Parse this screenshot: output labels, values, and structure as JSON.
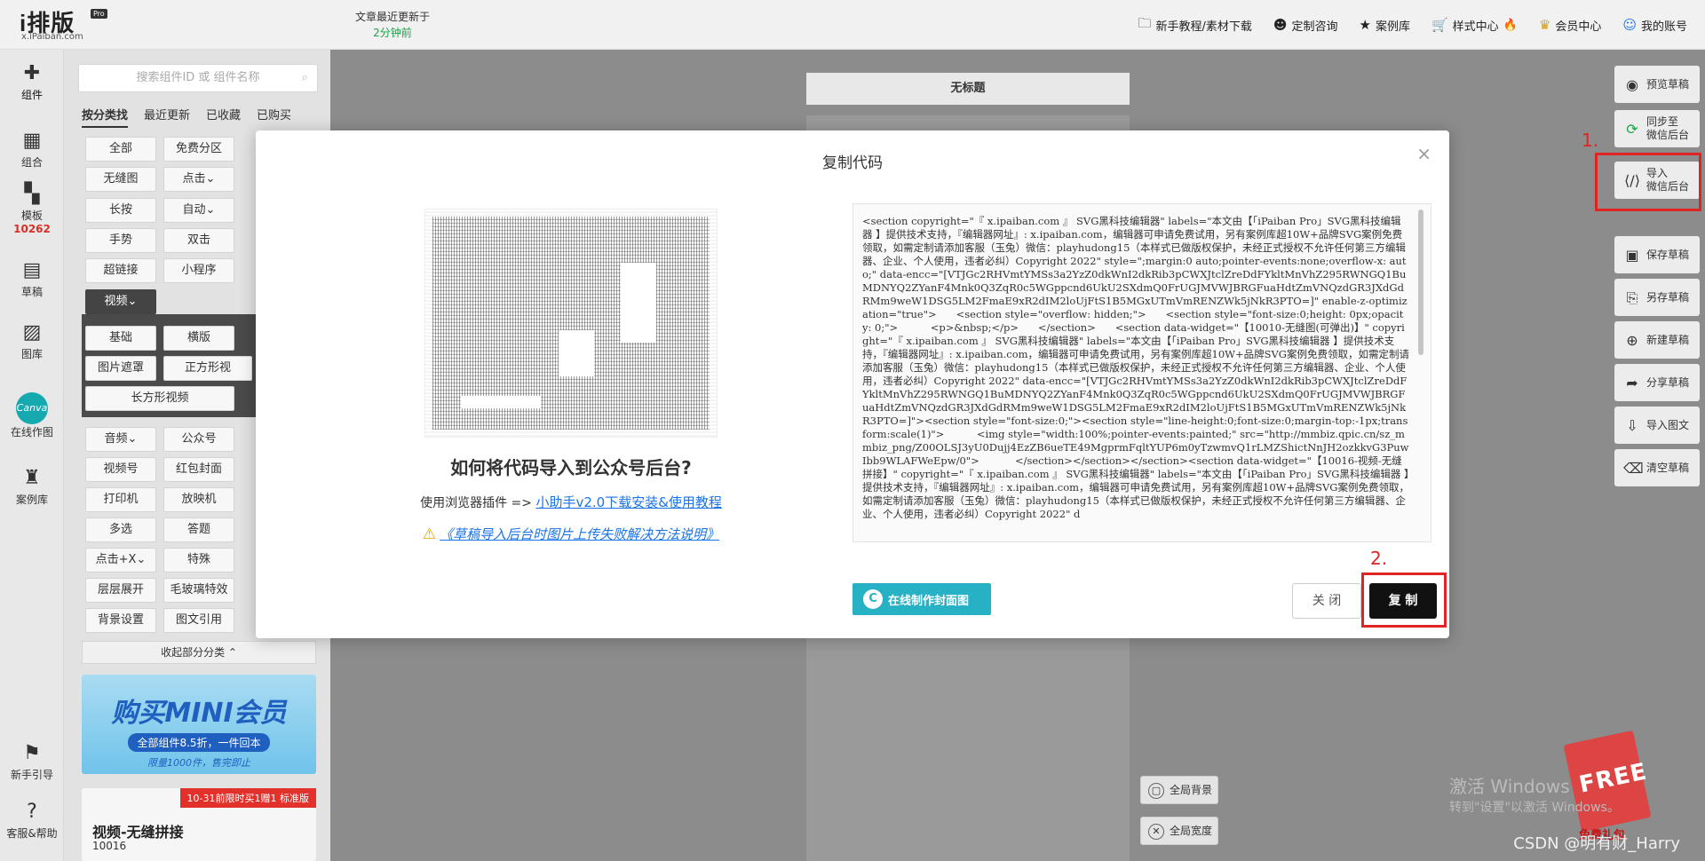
{
  "logo": {
    "name": "i排版",
    "badge": "Pro",
    "domain": "x.iPaiban.com"
  },
  "update_note": {
    "line1": "文章最近更新于",
    "line2": "2分钟前"
  },
  "top_nav": [
    {
      "icon": "folder-icon",
      "glyph": "🗀",
      "label": "新手教程/素材下载"
    },
    {
      "icon": "consult-icon",
      "glyph": "☻",
      "label": "定制咨询"
    },
    {
      "icon": "case-library-icon",
      "glyph": "★",
      "label": "案例库"
    },
    {
      "icon": "cart-icon",
      "glyph": "🛒",
      "label": "样式中心"
    },
    {
      "icon": "crown-icon",
      "glyph": "♛",
      "label": "会员中心"
    },
    {
      "icon": "user-icon",
      "glyph": "☺",
      "label": "我的账号"
    }
  ],
  "left_rail": {
    "components": "组件",
    "combo": "组合",
    "templates": "模板",
    "template_count": "10262",
    "drafts": "草稿",
    "images": "图库",
    "canva_label": "Canva",
    "online_design": "在线作图",
    "cases": "案例库",
    "newbie": "新手引导",
    "help": "客服&帮助"
  },
  "panel": {
    "search_placeholder": "搜索组件ID 或 组件名称",
    "tabs": [
      "按分类找",
      "最近更新",
      "已收藏",
      "已购买"
    ],
    "chips": {
      "all": "全部",
      "free": "免费分区",
      "image_wall": "无缝图",
      "click": "点击⌄",
      "long_press": "长按",
      "auto": "自动⌄",
      "gesture": "手势",
      "double_click": "双击",
      "hyperlink": "超链接",
      "mini_program": "小程序",
      "video": "视频⌄",
      "basic": "基础",
      "landscape": "横版",
      "image_mask": "图片遮罩",
      "square": "正方形视",
      "rect_video": "长方形视频",
      "audio": "音频⌄",
      "official": "公众号",
      "video_account": "视频号",
      "red_packet": "红包封面",
      "typewriter": "打印机",
      "projector": "放映机",
      "multi_select": "多选",
      "answer": "答题",
      "click_x": "点击+X⌄",
      "special": "特殊",
      "layer_expand": "层层展开",
      "glass": "毛玻璃特效",
      "bg_setting": "背景设置",
      "image_text": "图文引用"
    },
    "collapse": "收起部分分类 ⌃",
    "promo1": {
      "title": "购买MINI会员",
      "sub": "全部组件8.5折，一件回本",
      "note": "限量1000件，售完即止"
    },
    "promo2": {
      "tag": "10-31前限时买1赠1 标准版",
      "title": "视频-无缝拼接",
      "id": "10016"
    }
  },
  "canvas": {
    "doc_title": "无标题"
  },
  "global_options": {
    "bg": "全局背景",
    "width": "全局宽度"
  },
  "right_bar": {
    "preview": "预览草稿",
    "sync": "同步至\n微信后台",
    "import": "导入\n微信后台",
    "save": "保存草稿",
    "save_as": "另存草稿",
    "new": "新建草稿",
    "share": "分享草稿",
    "import_doc": "导入图文",
    "clear": "清空草稿",
    "step1": "1."
  },
  "gift": {
    "free": "FREE",
    "label": "免费礼包"
  },
  "activate": {
    "title": "激活 Windows",
    "sub": "转到\"设置\"以激活 Windows。"
  },
  "watermark": "CSDN @明有财_Harry",
  "modal": {
    "title": "复制代码",
    "close": "×",
    "help_title": "如何将代码导入到公众号后台?",
    "help_text": "使用浏览器插件 =>",
    "help_link": "小助手v2.0下载安装&使用教程",
    "warn_link": "《草稿导入后台时图片上传失败解决方法说明》",
    "code": "<section copyright=\"『 x.ipaiban.com 』 SVG黑科技编辑器\" labels=\"本文由【「iPaiban Pro」SVG黑科技编辑器 】提供技术支持，『编辑器网址』: x.ipaiban.com，编辑器可申请免费试用，另有案例库超10W+品牌SVG案例免费领取，如需定制请添加客服（玉兔）微信：playhudong15（本样式已做版权保护，未经正式授权不允许任何第三方编辑器、企业、个人使用，违者必纠）Copyright 2022\" style=\";margin:0 auto;pointer-events:none;overflow-x: auto;\" data-encc=\"[VTJGc2RHVmtYMSs3a2YzZ0dkWnI2dkRib3pCWXJtclZreDdFYkltMnVhZ295RWNGQ1BuMDNYQ2ZYanF4Mnk0Q3ZqR0c5WGppcnd6UkU2SXdmQ0FrUGJMVWJBRGFuaHdtZmVNQzdGR3JXdGdRMm9weW1DSG5LM2FmaE9xR2dIM2loUjFtS1B5MGxUTmVmRENZWk5jNkR3PTO=]\" enable-z-optimization=\"true\">      <section style=\"overflow: hidden;\">      <section style=\"font-size:0;height: 0px;opacity: 0;\">          <p>&nbsp;</p>      </section>      <section data-widget=\"【10010-无缝图(可弹出)】\" copyright=\"『 x.ipaiban.com 』 SVG黑科技编辑器\" labels=\"本文由【「iPaiban Pro」SVG黑科技编辑器 】提供技术支持，『编辑器网址』: x.ipaiban.com，编辑器可申请免费试用，另有案例库超10W+品牌SVG案例免费领取，如需定制请添加客服（玉兔）微信：playhudong15（本样式已做版权保护，未经正式授权不允许任何第三方编辑器、企业、个人使用，违者必纠）Copyright 2022\" data-encc=\"[VTJGc2RHVmtYMSs3a2YzZ0dkWnI2dkRib3pCWXJtclZreDdFYkltMnVhZ295RWNGQ1BuMDNYQ2ZYanF4Mnk0Q3ZqR0c5WGppcnd6UkU2SXdmQ0FrUGJMVWJBRGFuaHdtZmVNQzdGR3JXdGdRMm9weW1DSG5LM2FmaE9xR2dIM2loUjFtS1B5MGxUTmVmRENZWk5jNkR3PTO=]\"><section style=\"font-size:0;\"><section style=\"line-height:0;font-size:0;margin-top:-1px;transform:scale(1)\">          <img style=\"width:100%;pointer-events:painted;\" src=\"http://mmbiz.qpic.cn/sz_mmbiz_png/Z00OLSJ3yU0Dujj4EzZB6ueTE49MgprmFqltYUP6m0yTzwmvQ1rLMZShictNnJH2ozkkvG3PuwIbb9WLAFWeEpw/0\">           </section></section></section><section data-widget=\"【10016-视频-无缝拼接】\" copyright=\"『 x.ipaiban.com 』 SVG黑科技编辑器\" labels=\"本文由【「iPaiban Pro」SVG黑科技编辑器 】提供技术支持，『编辑器网址』: x.ipaiban.com，编辑器可申请免费试用，另有案例库超10W+品牌SVG案例免费领取，如需定制请添加客服（玉兔）微信：playhudong15（本样式已做版权保护，未经正式授权不允许任何第三方编辑器、企业、个人使用，违者必纠）Copyright 2022\" d",
    "canva_btn": "在线制作封面图",
    "close_btn": "关 闭",
    "copy_btn": "复 制",
    "step2": "2."
  }
}
